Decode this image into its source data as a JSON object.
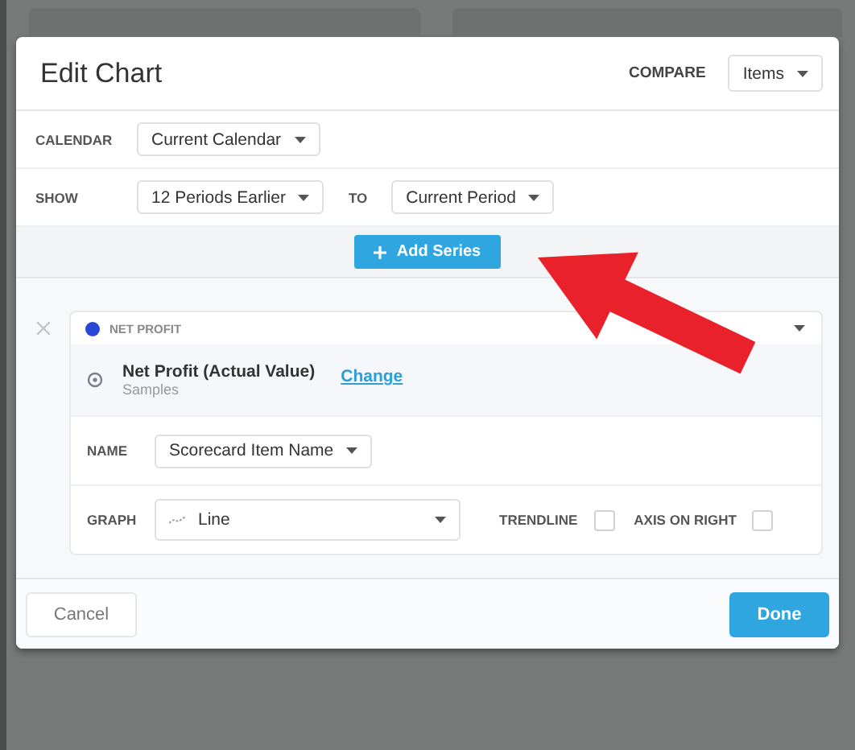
{
  "dialog": {
    "title": "Edit Chart",
    "compare": {
      "label": "COMPARE",
      "value": "Items"
    },
    "calendar": {
      "label": "CALENDAR",
      "value": "Current Calendar"
    },
    "show": {
      "label": "SHOW",
      "from": "12 Periods Earlier",
      "to_label": "TO",
      "to": "Current Period"
    },
    "add_series_button": "Add Series",
    "series": [
      {
        "name": "NET PROFIT",
        "color": "#2a48d6",
        "item": "Net Profit (Actual Value)",
        "source": "Samples",
        "change_link": "Change",
        "name_label": "NAME",
        "name_value": "Scorecard Item Name",
        "graph_label": "GRAPH",
        "graph_value": "Line",
        "trendline": {
          "label": "TRENDLINE",
          "checked": false
        },
        "axis_on_right": {
          "label": "AXIS ON RIGHT",
          "checked": false
        }
      }
    ],
    "buttons": {
      "cancel": "Cancel",
      "done": "Done"
    }
  }
}
